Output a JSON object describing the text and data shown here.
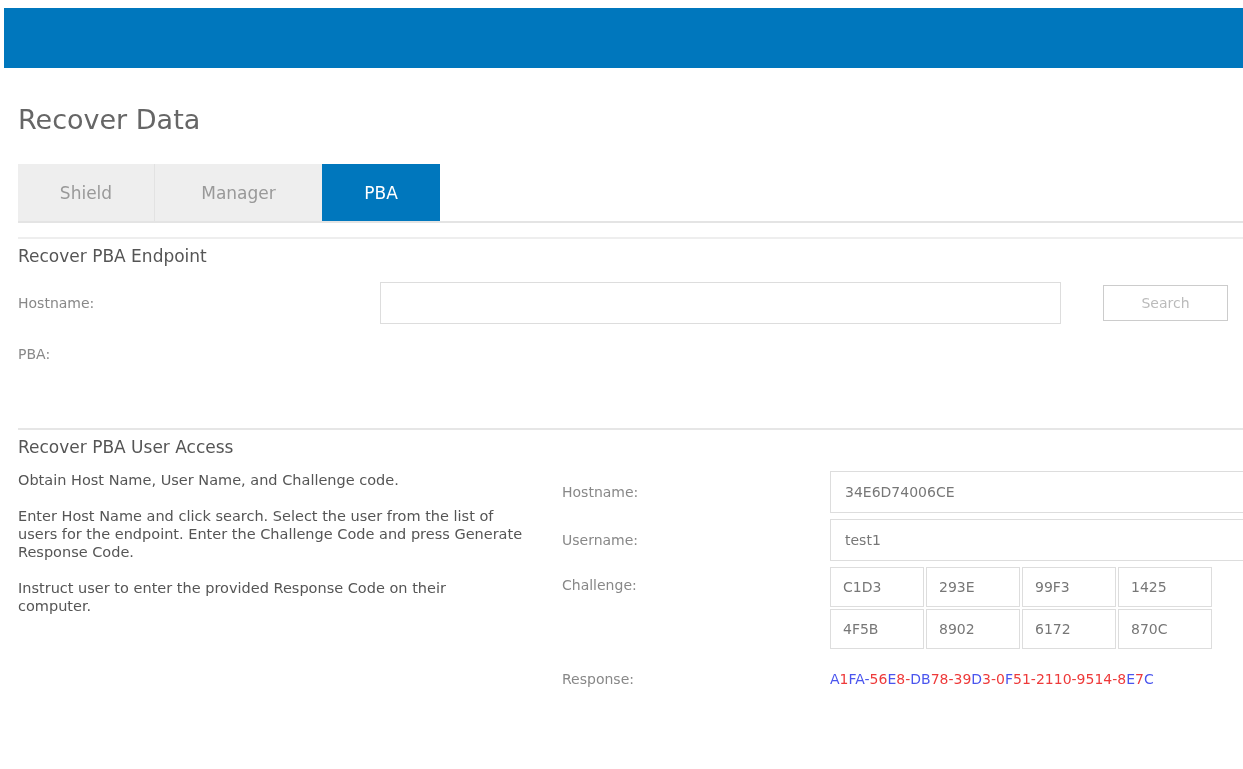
{
  "page_title": "Recover Data",
  "tabs": [
    {
      "label": "Shield",
      "selected": false
    },
    {
      "label": "Manager",
      "selected": false
    },
    {
      "label": "PBA",
      "selected": true
    }
  ],
  "endpoint_section": {
    "heading": "Recover PBA Endpoint",
    "hostname_label": "Hostname:",
    "search_button": "Search",
    "search_disabled": true,
    "pba_label": "PBA:"
  },
  "access_section": {
    "heading": "Recover PBA User Access",
    "instructions": [
      "Obtain Host Name, User Name, and Challenge code.",
      "Enter Host Name and click search. Select the user from the list of users for the endpoint. Enter the Challenge Code and press Generate Response Code.",
      "Instruct user to enter the provided Response Code on their computer."
    ],
    "hostname_label": "Hostname:",
    "hostname_value": "34E6D74006CE",
    "username_label": "Username:",
    "username_value": "test1",
    "challenge_label": "Challenge:",
    "challenge_codes": [
      "C1D3",
      "293E",
      "99F3",
      "1425",
      "4F5B",
      "8902",
      "6172",
      "870C"
    ],
    "response_label": "Response:",
    "response": [
      {
        "text": "A",
        "color": "#4a55ee"
      },
      {
        "text": "1",
        "color": "#ee3a3a"
      },
      {
        "text": "FA-",
        "color": "#4a55ee"
      },
      {
        "text": "56",
        "color": "#ee3a3a"
      },
      {
        "text": "E",
        "color": "#4a55ee"
      },
      {
        "text": "8-",
        "color": "#ee3a3a"
      },
      {
        "text": "DB",
        "color": "#4a55ee"
      },
      {
        "text": "78-39",
        "color": "#ee3a3a"
      },
      {
        "text": "D",
        "color": "#4a55ee"
      },
      {
        "text": "3-0",
        "color": "#ee3a3a"
      },
      {
        "text": "F",
        "color": "#4a55ee"
      },
      {
        "text": "51-2110-9514-8",
        "color": "#ee3a3a"
      },
      {
        "text": "E",
        "color": "#4a55ee"
      },
      {
        "text": "7",
        "color": "#ee3a3a"
      },
      {
        "text": "C",
        "color": "#4a55ee"
      }
    ]
  }
}
